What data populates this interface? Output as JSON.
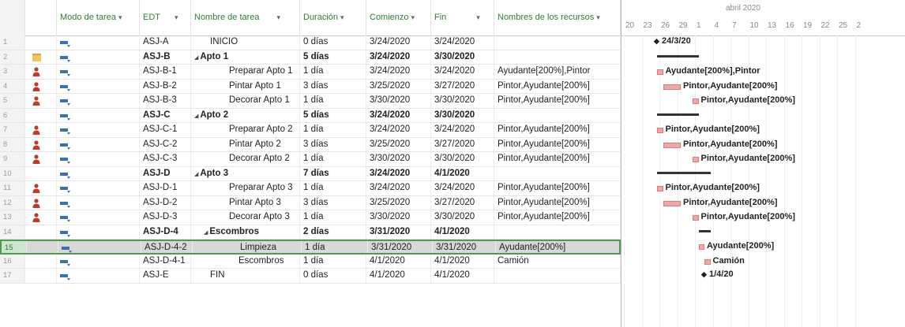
{
  "columns": {
    "mode": "Modo de tarea",
    "wbs": "EDT",
    "name": "Nombre de tarea",
    "duration": "Duración",
    "start": "Comienzo",
    "finish": "Fin",
    "resources": "Nombres de los recursos"
  },
  "gantt": {
    "month": "abril 2020",
    "ticks": [
      "20",
      "23",
      "26",
      "29",
      "1",
      "4",
      "7",
      "10",
      "13",
      "16",
      "19",
      "22",
      "25",
      "2"
    ]
  },
  "rows": [
    {
      "n": "1",
      "ind": "",
      "wbs": "ASJ-A",
      "name": "INICIO",
      "dur": "0 días",
      "start": "3/24/2020",
      "end": "3/24/2020",
      "res": "",
      "bold": false,
      "level": 0,
      "summary": false,
      "gantt_label": "24/3/20"
    },
    {
      "n": "2",
      "ind": "note",
      "wbs": "ASJ-B",
      "name": "Apto 1",
      "dur": "5 días",
      "start": "3/24/2020",
      "end": "3/30/2020",
      "res": "",
      "bold": true,
      "level": 0,
      "summary": true,
      "gantt_label": ""
    },
    {
      "n": "3",
      "ind": "person",
      "wbs": "ASJ-B-1",
      "name": "Preparar Apto 1",
      "dur": "1 día",
      "start": "3/24/2020",
      "end": "3/24/2020",
      "res": "Ayudante[200%],Pintor",
      "bold": false,
      "level": 2,
      "summary": false,
      "gantt_label": "Ayudante[200%],Pintor"
    },
    {
      "n": "4",
      "ind": "person",
      "wbs": "ASJ-B-2",
      "name": "Pintar Apto 1",
      "dur": "3 días",
      "start": "3/25/2020",
      "end": "3/27/2020",
      "res": "Pintor,Ayudante[200%]",
      "bold": false,
      "level": 2,
      "summary": false,
      "gantt_label": "Pintor,Ayudante[200%]"
    },
    {
      "n": "5",
      "ind": "person",
      "wbs": "ASJ-B-3",
      "name": "Decorar Apto 1",
      "dur": "1 día",
      "start": "3/30/2020",
      "end": "3/30/2020",
      "res": "Pintor,Ayudante[200%]",
      "bold": false,
      "level": 2,
      "summary": false,
      "gantt_label": "Pintor,Ayudante[200%]"
    },
    {
      "n": "6",
      "ind": "",
      "wbs": "ASJ-C",
      "name": "Apto 2",
      "dur": "5 días",
      "start": "3/24/2020",
      "end": "3/30/2020",
      "res": "",
      "bold": true,
      "level": 0,
      "summary": true,
      "gantt_label": ""
    },
    {
      "n": "7",
      "ind": "person",
      "wbs": "ASJ-C-1",
      "name": "Preparar Apto 2",
      "dur": "1 día",
      "start": "3/24/2020",
      "end": "3/24/2020",
      "res": "Pintor,Ayudante[200%]",
      "bold": false,
      "level": 2,
      "summary": false,
      "gantt_label": "Pintor,Ayudante[200%]"
    },
    {
      "n": "8",
      "ind": "person",
      "wbs": "ASJ-C-2",
      "name": "Pintar Apto 2",
      "dur": "3 días",
      "start": "3/25/2020",
      "end": "3/27/2020",
      "res": "Pintor,Ayudante[200%]",
      "bold": false,
      "level": 2,
      "summary": false,
      "gantt_label": "Pintor,Ayudante[200%]"
    },
    {
      "n": "9",
      "ind": "person",
      "wbs": "ASJ-C-3",
      "name": "Decorar Apto 2",
      "dur": "1 día",
      "start": "3/30/2020",
      "end": "3/30/2020",
      "res": "Pintor,Ayudante[200%]",
      "bold": false,
      "level": 2,
      "summary": false,
      "gantt_label": "Pintor,Ayudante[200%]"
    },
    {
      "n": "10",
      "ind": "",
      "wbs": "ASJ-D",
      "name": "Apto 3",
      "dur": "7 días",
      "start": "3/24/2020",
      "end": "4/1/2020",
      "res": "",
      "bold": true,
      "level": 0,
      "summary": true,
      "gantt_label": ""
    },
    {
      "n": "11",
      "ind": "person",
      "wbs": "ASJ-D-1",
      "name": "Preparar Apto 3",
      "dur": "1 día",
      "start": "3/24/2020",
      "end": "3/24/2020",
      "res": "Pintor,Ayudante[200%]",
      "bold": false,
      "level": 2,
      "summary": false,
      "gantt_label": "Pintor,Ayudante[200%]"
    },
    {
      "n": "12",
      "ind": "person",
      "wbs": "ASJ-D-2",
      "name": "Pintar Apto 3",
      "dur": "3 días",
      "start": "3/25/2020",
      "end": "3/27/2020",
      "res": "Pintor,Ayudante[200%]",
      "bold": false,
      "level": 2,
      "summary": false,
      "gantt_label": "Pintor,Ayudante[200%]"
    },
    {
      "n": "13",
      "ind": "person",
      "wbs": "ASJ-D-3",
      "name": "Decorar Apto 3",
      "dur": "1 día",
      "start": "3/30/2020",
      "end": "3/30/2020",
      "res": "Pintor,Ayudante[200%]",
      "bold": false,
      "level": 2,
      "summary": false,
      "gantt_label": "Pintor,Ayudante[200%]"
    },
    {
      "n": "14",
      "ind": "",
      "wbs": "ASJ-D-4",
      "name": "Escombros",
      "dur": "2 días",
      "start": "3/31/2020",
      "end": "4/1/2020",
      "res": "",
      "bold": true,
      "level": 1,
      "summary": true,
      "gantt_label": ""
    },
    {
      "n": "15",
      "ind": "",
      "wbs": "ASJ-D-4-2",
      "name": "Limpieza",
      "dur": "1 día",
      "start": "3/31/2020",
      "end": "3/31/2020",
      "res": "Ayudante[200%]",
      "bold": false,
      "level": 3,
      "summary": false,
      "selected": true,
      "gantt_label": "Ayudante[200%]"
    },
    {
      "n": "16",
      "ind": "",
      "wbs": "ASJ-D-4-1",
      "name": "Escombros",
      "dur": "1 día",
      "start": "4/1/2020",
      "end": "4/1/2020",
      "res": "Camión",
      "bold": false,
      "level": 3,
      "summary": false,
      "gantt_label": "Camión"
    },
    {
      "n": "17",
      "ind": "",
      "wbs": "ASJ-E",
      "name": "FIN",
      "dur": "0 días",
      "start": "4/1/2020",
      "end": "4/1/2020",
      "res": "",
      "bold": false,
      "level": 0,
      "summary": false,
      "gantt_label": "1/4/20"
    }
  ],
  "colors": {
    "accent": "#2e7d32",
    "bar": "#f1a7a7",
    "person": "#c0392b",
    "mode": "#3a6fb0"
  }
}
